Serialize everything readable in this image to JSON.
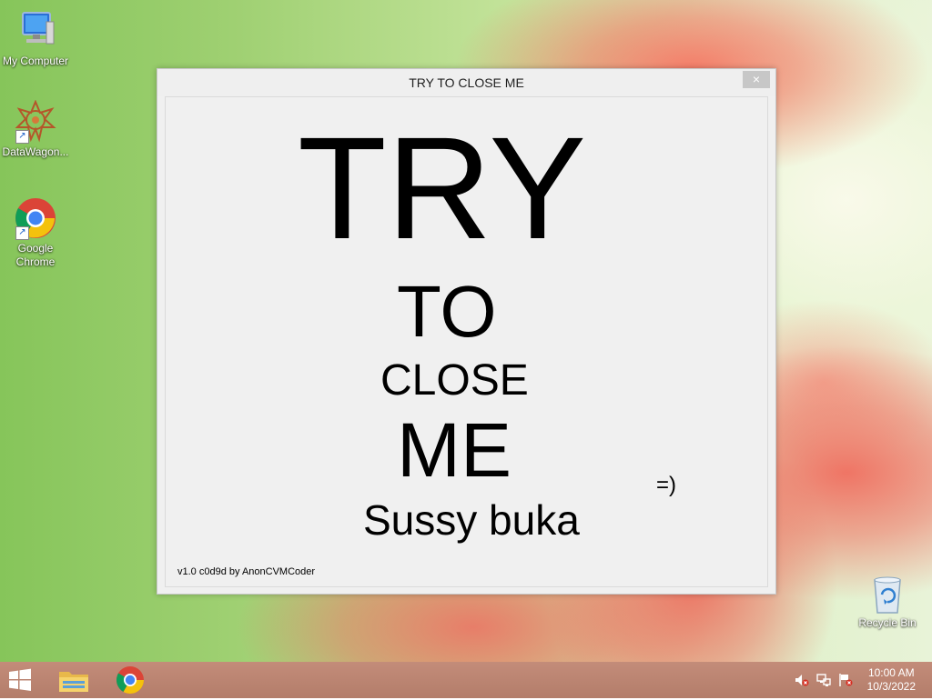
{
  "desktop": {
    "icons": [
      {
        "label": "My Computer",
        "icon": "computer-icon"
      },
      {
        "label": "DataWagon...",
        "icon": "datawagon-icon"
      },
      {
        "label": "Google Chrome",
        "icon": "chrome-icon"
      },
      {
        "label": "Recycle Bin",
        "icon": "recycle-bin-icon"
      }
    ]
  },
  "window": {
    "title": "TRY TO CLOSE ME",
    "close_glyph": "×",
    "lines": {
      "try": "TRY",
      "to": "TO",
      "close": "CLOSE",
      "me": "ME",
      "smile": "=)",
      "sussy": "Sussy buka"
    },
    "version": "v1.0 c0d9d by AnonCVMCoder"
  },
  "taskbar": {
    "apps": [
      {
        "name": "file-explorer",
        "icon": "folder-icon"
      },
      {
        "name": "google-chrome",
        "icon": "chrome-icon"
      }
    ],
    "tray": [
      "speaker-muted-icon",
      "network-icon",
      "action-center-flag-icon"
    ],
    "clock": {
      "time": "10:00 AM",
      "date": "10/3/2022"
    }
  },
  "colors": {
    "window_bg": "#f0f0f0",
    "taskbar": "#b07a66",
    "close_button": "#c7c7c7"
  }
}
